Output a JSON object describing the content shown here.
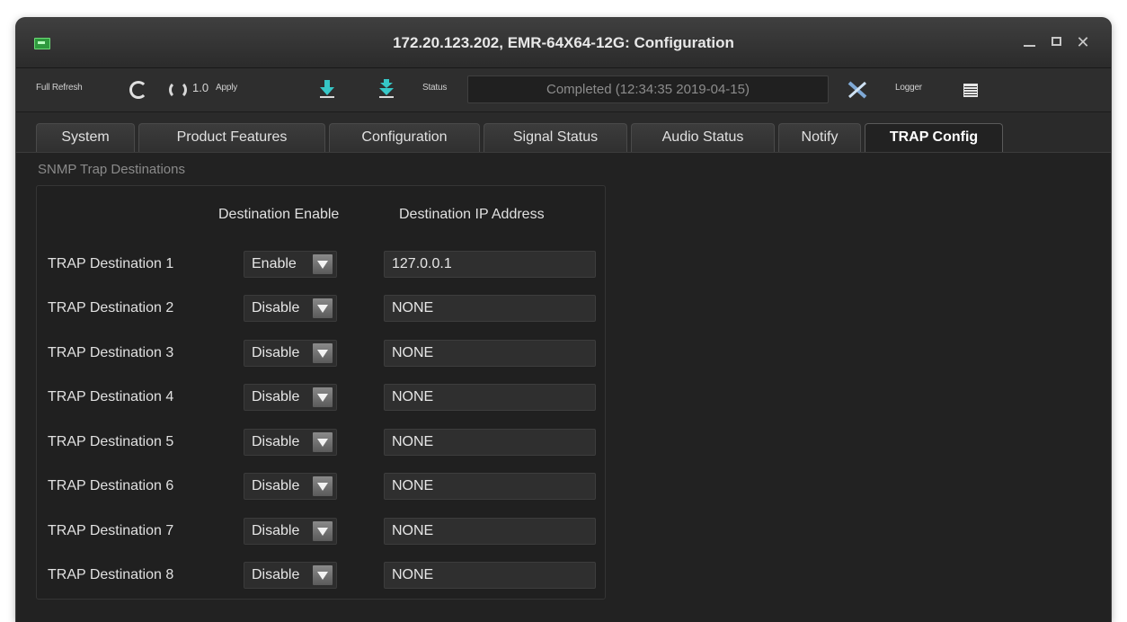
{
  "window": {
    "title": "172.20.123.202, EMR-64X64-12G: Configuration",
    "close_glyph": "✕"
  },
  "toolbar": {
    "full_refresh_label": "Full Refresh",
    "rate_value": "1.0",
    "apply_label": "Apply",
    "status_label": "Status",
    "status_value": "Completed  (12:34:35 2019-04-15)",
    "logger_label": "Logger",
    "icons": [
      "refresh-icon",
      "sync-icon",
      "download-icon",
      "download-all-icon",
      "clear-icon",
      "logger-icon"
    ]
  },
  "tabs": [
    {
      "label": "System"
    },
    {
      "label": "Product Features"
    },
    {
      "label": "Configuration"
    },
    {
      "label": "Signal Status"
    },
    {
      "label": "Audio Status"
    },
    {
      "label": "Notify"
    },
    {
      "label": "TRAP Config",
      "active": true
    }
  ],
  "trap": {
    "group_title": "SNMP Trap Destinations",
    "col_enable": "Destination Enable",
    "col_ip": "Destination IP Address",
    "rows": [
      {
        "label": "TRAP Destination 1",
        "enable": "Enable",
        "ip": "127.0.0.1"
      },
      {
        "label": "TRAP Destination 2",
        "enable": "Disable",
        "ip": "NONE"
      },
      {
        "label": "TRAP Destination 3",
        "enable": "Disable",
        "ip": "NONE"
      },
      {
        "label": "TRAP Destination 4",
        "enable": "Disable",
        "ip": "NONE"
      },
      {
        "label": "TRAP Destination 5",
        "enable": "Disable",
        "ip": "NONE"
      },
      {
        "label": "TRAP Destination 6",
        "enable": "Disable",
        "ip": "NONE"
      },
      {
        "label": "TRAP Destination 7",
        "enable": "Disable",
        "ip": "NONE"
      },
      {
        "label": "TRAP Destination 8",
        "enable": "Disable",
        "ip": "NONE"
      }
    ]
  },
  "colors": {
    "accent_arrow": "#36c7c7",
    "background": "#222222"
  }
}
